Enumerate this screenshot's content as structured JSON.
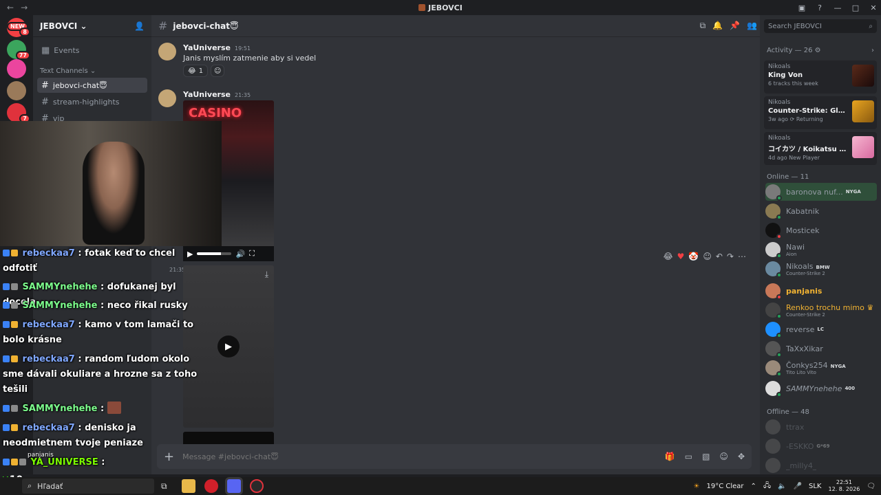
{
  "titlebar": {
    "title": "JEBOVCI"
  },
  "rail": {
    "new_badge": "NEW",
    "badges": [
      "8",
      "77",
      "7"
    ]
  },
  "sidebar": {
    "guild_name": "JEBOVCI",
    "events_label": "Events",
    "category": "Text Channels",
    "channels": [
      "jebovci-chat😇",
      "stream-highlights",
      "vip"
    ]
  },
  "header": {
    "channel": "jebovci-chat😇"
  },
  "messages": [
    {
      "author": "YaUniverse",
      "time": "19:51",
      "text": "Janis myslím zatmenie aby si vedel",
      "reaction_count": "1"
    },
    {
      "author": "YaUniverse",
      "time": "21:35",
      "image_text": "CASINO"
    },
    {
      "time": "21:35"
    }
  ],
  "composer": {
    "placeholder": "Message #jebovci-chat😇"
  },
  "right": {
    "search_placeholder": "Search JEBOVCI",
    "activity_header": "Activity — 26",
    "activities": [
      {
        "user": "Nikoals",
        "title": "King Von",
        "sub": "6 tracks this week"
      },
      {
        "user": "Nikoals",
        "title": "Counter-Strike: Global Off...",
        "sub": "3w ago  ⟳ Returning"
      },
      {
        "user": "Nikoals",
        "title": "コイカツ / Koikatsu Party",
        "sub": "4d ago  New Player"
      }
    ],
    "online_header": "Online — 11",
    "online": [
      {
        "name": "baronova nuf...",
        "tag": "NYGA",
        "sub": ""
      },
      {
        "name": "Kabatnik",
        "tag": "",
        "sub": ""
      },
      {
        "name": "Mosticek",
        "tag": "",
        "sub": ""
      },
      {
        "name": "Nawi",
        "tag": "",
        "sub": "Aion"
      },
      {
        "name": "Nikoals",
        "tag": "BMW",
        "sub": "Counter-Strike 2"
      },
      {
        "name": "panjanis",
        "tag": "",
        "sub": ""
      },
      {
        "name": "Renkoo trochu mimo",
        "tag": "",
        "sub": "Counter-Strike 2"
      },
      {
        "name": "reverse",
        "tag": "LC",
        "sub": ""
      },
      {
        "name": "TaXxXikar",
        "tag": "",
        "sub": ""
      },
      {
        "name": "Čonkys254",
        "tag": "NYGA",
        "sub": "Tito Lito Vito"
      },
      {
        "name": "SAMMYnehehe",
        "tag": "400",
        "sub": ""
      }
    ],
    "offline_header": "Offline — 48",
    "offline": [
      {
        "name": "ttrax",
        "tag": ""
      },
      {
        "name": "-ESKKO",
        "tag": "G*69"
      },
      {
        "name": "_milly4_",
        "tag": ""
      }
    ]
  },
  "overlay_chat": [
    {
      "user": "rebeckaa7",
      "text": ": fotak keď to chcel",
      "cls": "u1"
    },
    {
      "user": "",
      "text": "odfotiť",
      "cls": ""
    },
    {
      "user": "SAMMYnehehe",
      "text": ": dofukanej byl docela",
      "cls": "u2"
    },
    {
      "user": "SAMMYnehehe",
      "text": ": neco řikal rusky",
      "cls": "u2"
    },
    {
      "user": "rebeckaa7",
      "text": ": kamo v tom lamači to",
      "cls": "u1"
    },
    {
      "user": "",
      "text": "bolo krásne",
      "cls": ""
    },
    {
      "user": "rebeckaa7",
      "text": ": random ľudom okolo",
      "cls": "u1"
    },
    {
      "user": "",
      "text": "sme dávali okuliare a hrozne sa z toho",
      "cls": ""
    },
    {
      "user": "",
      "text": "tešili",
      "cls": ""
    },
    {
      "user": "SAMMYnehehe",
      "text": ":",
      "cls": "u2"
    },
    {
      "user": "rebeckaa7",
      "text": ": denisko ja",
      "cls": "u1"
    },
    {
      "user": "",
      "text": "neodmietnem tvoje peniaze",
      "cls": ""
    },
    {
      "user": "YA_UNIVERSE",
      "text": ":",
      "cls": "u3"
    }
  ],
  "overlay_misc": {
    "sub_count": "10",
    "mini_label": "panjanis"
  },
  "taskbar": {
    "search": "Hľadať",
    "weather": "19°C  Clear",
    "lang": "SLK",
    "time": "22:51",
    "date": "12. 8. 2026"
  }
}
